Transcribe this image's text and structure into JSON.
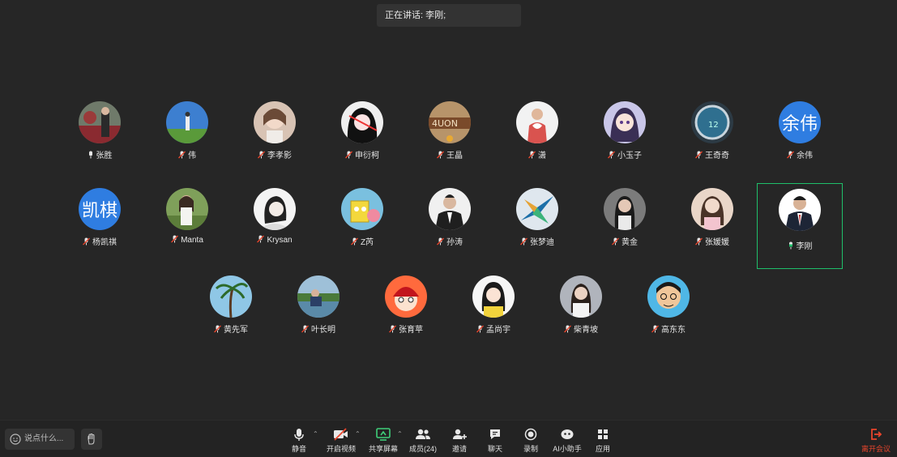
{
  "banner": {
    "text": "正在讲话: 李刚;"
  },
  "participants_row1": [
    {
      "name": "张胜",
      "mic": "on",
      "avatar": "photo-flowers"
    },
    {
      "name": "伟",
      "mic": "muted",
      "avatar": "photo-sky"
    },
    {
      "name": "李孝影",
      "mic": "muted",
      "avatar": "photo-girl"
    },
    {
      "name": "申衍柯",
      "mic": "muted",
      "avatar": "cartoon-girl"
    },
    {
      "name": "王晶",
      "mic": "muted",
      "avatar": "photo-sign"
    },
    {
      "name": "潇",
      "mic": "muted",
      "avatar": "photo-heart"
    },
    {
      "name": "小玉子",
      "mic": "muted",
      "avatar": "cartoon-anime"
    },
    {
      "name": "王奇奇",
      "mic": "muted",
      "avatar": "photo-watch"
    },
    {
      "name": "余伟",
      "mic": "muted",
      "avatar": "text",
      "avatar_text": "余伟"
    }
  ],
  "participants_row2": [
    {
      "name": "杨凯祺",
      "mic": "muted",
      "avatar": "text",
      "avatar_text": "凯棋"
    },
    {
      "name": "Manta",
      "mic": "muted",
      "avatar": "photo-grass"
    },
    {
      "name": "Krysan",
      "mic": "muted",
      "avatar": "sketch"
    },
    {
      "name": "Z芮",
      "mic": "muted",
      "avatar": "cartoon-sponge"
    },
    {
      "name": "孙涛",
      "mic": "muted",
      "avatar": "photo-suit"
    },
    {
      "name": "张梦迪",
      "mic": "muted",
      "avatar": "bird"
    },
    {
      "name": "黄金",
      "mic": "muted",
      "avatar": "photo-woman"
    },
    {
      "name": "张媛媛",
      "mic": "muted",
      "avatar": "photo-pink"
    },
    {
      "name": "李刚",
      "mic": "speaking",
      "avatar": "photo-suit2",
      "active": true
    }
  ],
  "participants_row3": [
    {
      "name": "黄先军",
      "mic": "muted",
      "avatar": "palm"
    },
    {
      "name": "叶长明",
      "mic": "muted",
      "avatar": "photo-lake"
    },
    {
      "name": "张育苹",
      "mic": "muted",
      "avatar": "cartoon-red"
    },
    {
      "name": "孟尚宇",
      "mic": "muted",
      "avatar": "cartoon-yellow"
    },
    {
      "name": "柴青坡",
      "mic": "muted",
      "avatar": "photo-woman2"
    },
    {
      "name": "高东东",
      "mic": "muted",
      "avatar": "cartoon-man"
    }
  ],
  "toolbar": {
    "chat_placeholder": "说点什么...",
    "mute": "静音",
    "video": "开启视频",
    "share": "共享屏幕",
    "members": "成员(24)",
    "invite": "邀请",
    "chat": "聊天",
    "record": "录制",
    "ai": "AI小助手",
    "apps": "应用",
    "leave": "离开会议"
  },
  "colors": {
    "background": "#262626",
    "active_border": "#1fbf6a",
    "text_avatar": "#2f7de1",
    "leave": "#e8452c",
    "muted_mic": "#e8452c"
  }
}
